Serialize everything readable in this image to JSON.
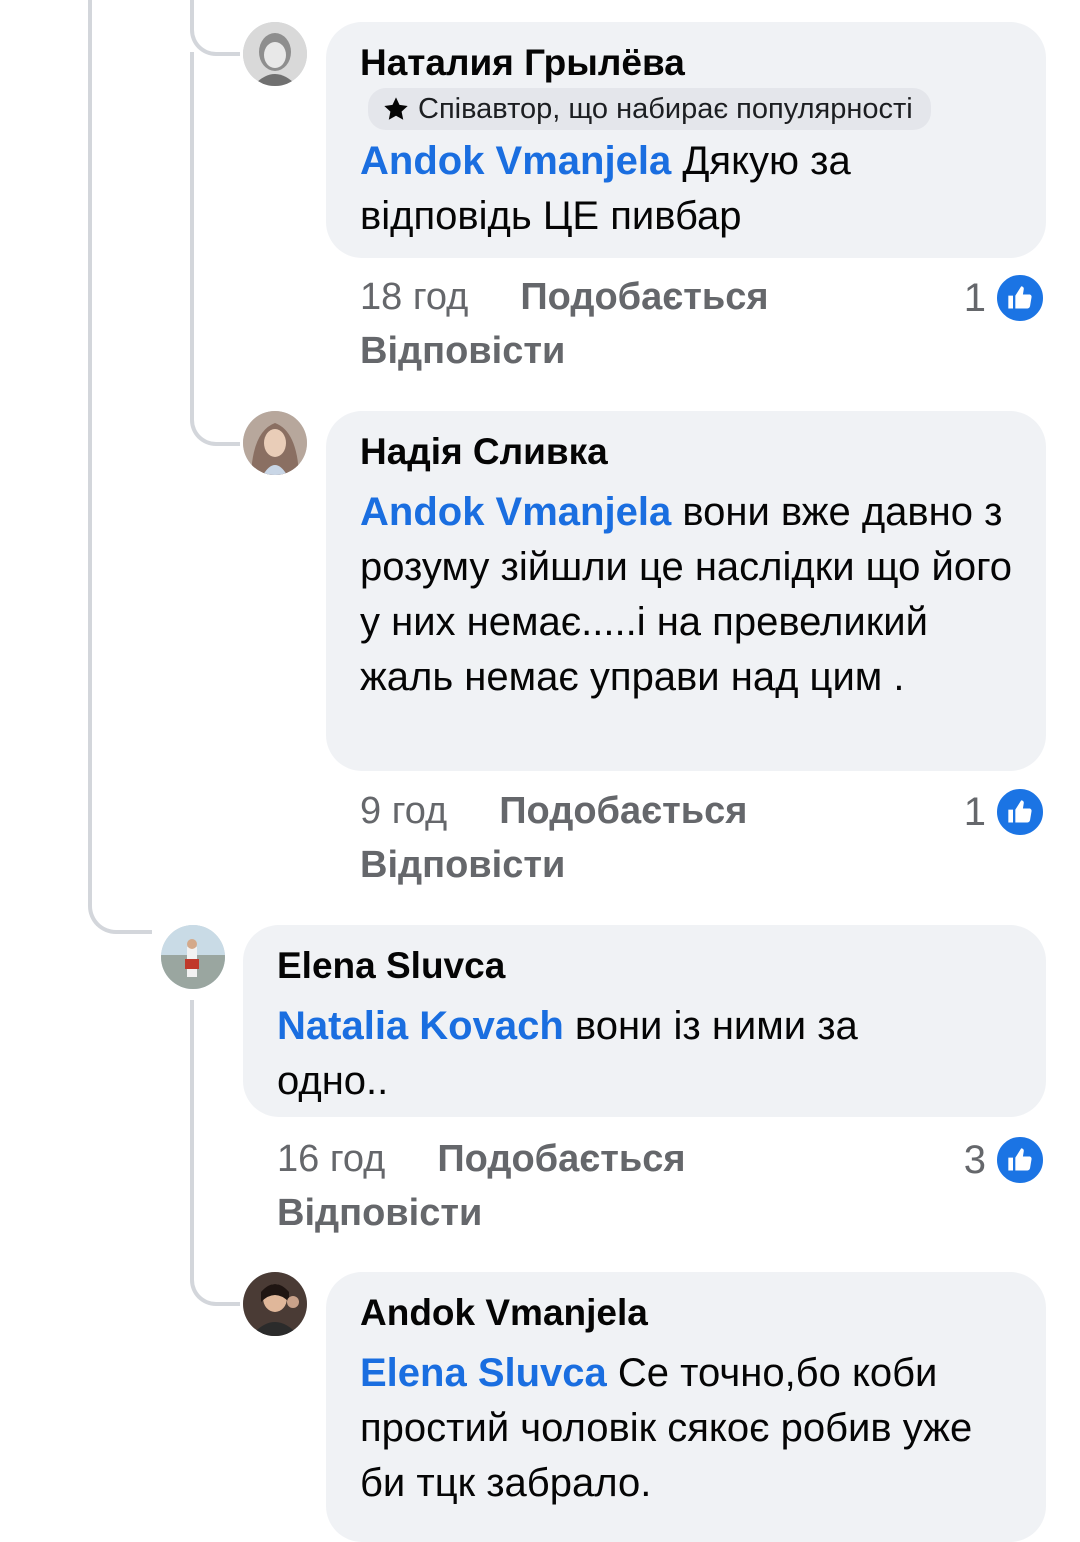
{
  "colors": {
    "mention": "#1a6ee0",
    "bubble": "#f0f2f5",
    "like": "#1b74e4",
    "meta": "#65676b"
  },
  "comments": [
    {
      "author": "Наталия Грылёва",
      "badge": "Співавтор, що набирає популярності",
      "mention": "Andok Vmanjela",
      "text": " Дякую за відповідь ЦЕ пивбар",
      "time": "18 год",
      "like_label": "Подобається",
      "reply_label": "Відповісти",
      "likes": "1"
    },
    {
      "author": "Надія Сливка",
      "mention": "Andok Vmanjela",
      "text": " вони вже давно з розуму зійшли це наслідки що його у них немає.....і на превеликий жаль немає управи над цим .",
      "time": "9 год",
      "like_label": "Подобається",
      "reply_label": "Відповісти",
      "likes": "1"
    },
    {
      "author": "Elena Sluvca",
      "mention": "Natalia Kovach",
      "text": " вони із ними за одно..",
      "time": "16 год",
      "like_label": "Подобається",
      "reply_label": "Відповісти",
      "likes": "3"
    },
    {
      "author": "Andok Vmanjela",
      "mention": "Elena Sluvca",
      "text": " Се точно,бо коби простий чоловік сякоє робив уже би тцк забрало."
    }
  ]
}
